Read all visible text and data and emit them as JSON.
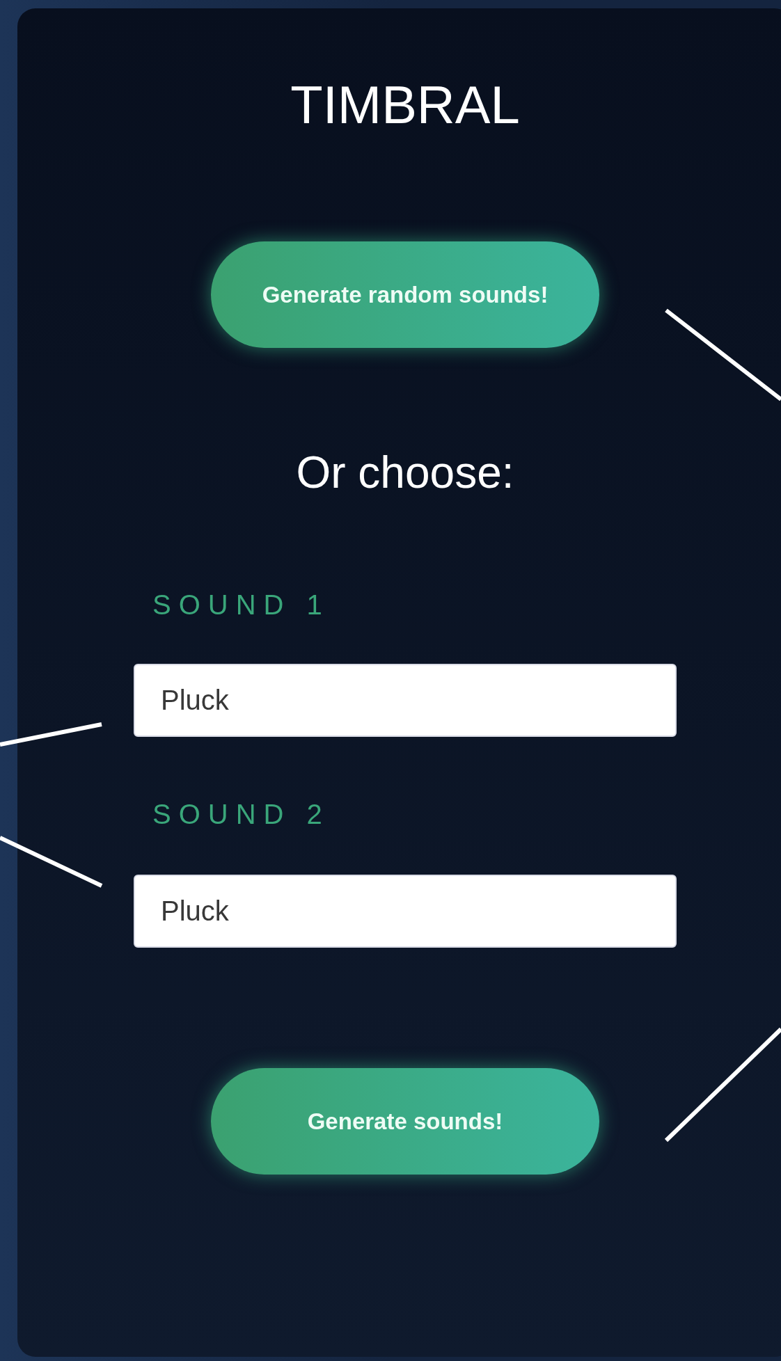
{
  "app": {
    "title": "TIMBRAL"
  },
  "random_button": {
    "label": "Generate random sounds!"
  },
  "prompt": "Or choose:",
  "sounds": [
    {
      "label": "SOUND 1",
      "value": "Pluck"
    },
    {
      "label": "SOUND 2",
      "value": "Pluck"
    }
  ],
  "generate_button": {
    "label": "Generate sounds!"
  }
}
